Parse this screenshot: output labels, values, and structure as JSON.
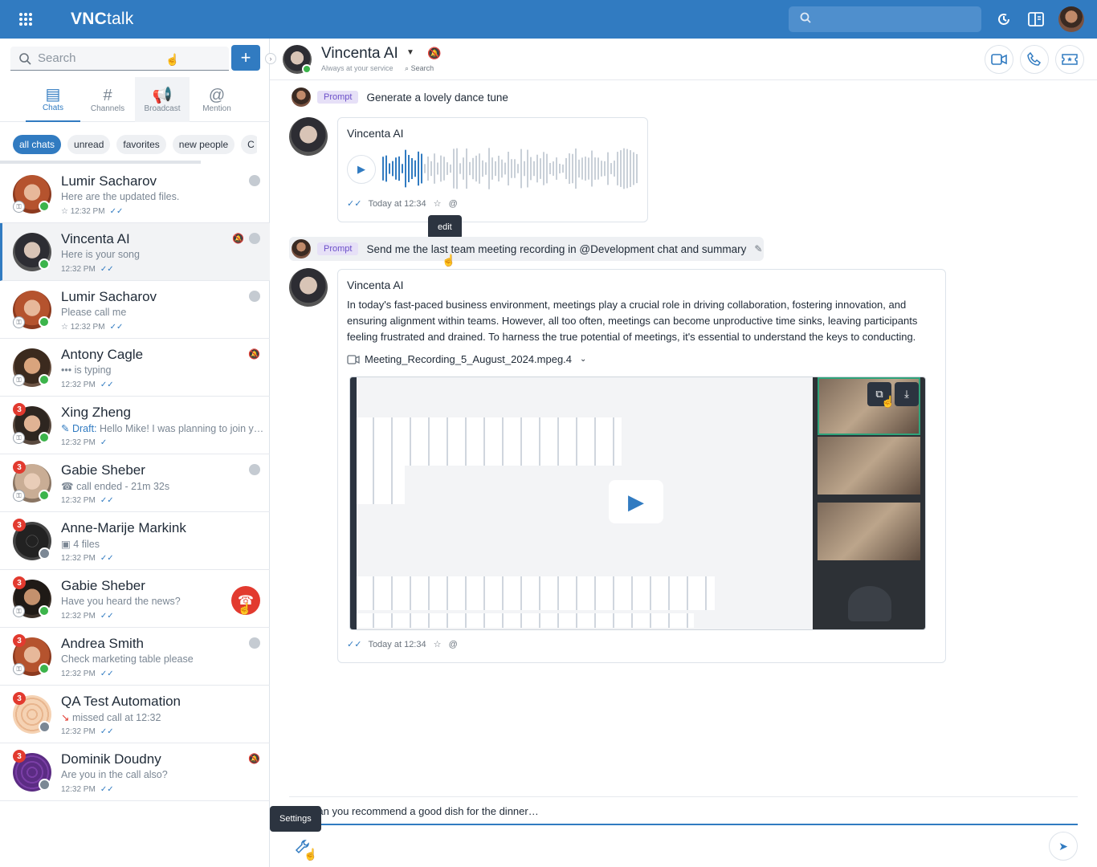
{
  "app": {
    "logo_bold": "VNC",
    "logo_light": "talk"
  },
  "topbar": {
    "icons": [
      "apps-grid-icon",
      "search-icon",
      "history-icon",
      "panel-icon",
      "user-avatar"
    ]
  },
  "sidebar": {
    "search_placeholder": "Search",
    "tabs": [
      {
        "label": "Chats",
        "icon": "chat-icon"
      },
      {
        "label": "Channels",
        "icon": "hash-icon"
      },
      {
        "label": "Broadcast",
        "icon": "megaphone-icon"
      },
      {
        "label": "Mention",
        "icon": "at-icon"
      }
    ],
    "filters": [
      "all chats",
      "unread",
      "favorites",
      "new people",
      "C"
    ],
    "chats": [
      {
        "name": "Lumir Sacharov",
        "msg": "Here are the updated files.",
        "time": "12:32 PM",
        "badge": ""
      },
      {
        "name": "Vincenta AI",
        "msg": "Here is your song",
        "time": "12:32 PM",
        "badge": ""
      },
      {
        "name": "Lumir Sacharov",
        "msg": "Please call me",
        "time": "12:32 PM",
        "badge": ""
      },
      {
        "name": "Antony Cagle",
        "msg": "is typing",
        "time": "12:32 PM",
        "badge": ""
      },
      {
        "name": "Xing Zheng",
        "draft": "Draft:",
        "msg": "Hello Mike! I was planning to join yo…",
        "time": "12:32 PM",
        "badge": "3"
      },
      {
        "name": "Gabie Sheber",
        "msg": "call ended - 21m 32s",
        "time": "12:32 PM",
        "badge": "3"
      },
      {
        "name": "Anne-Marije Markink",
        "msg": "4 files",
        "time": "12:32 PM",
        "badge": "3"
      },
      {
        "name": "Gabie Sheber",
        "msg": "Have you heard the news?",
        "time": "12:32 PM",
        "badge": "3"
      },
      {
        "name": "Andrea Smith",
        "msg": "Check marketing table please",
        "time": "12:32 PM",
        "badge": "3"
      },
      {
        "name": "QA Test Automation",
        "msg": "missed call at 12:32",
        "time": "12:32 PM",
        "badge": "3"
      },
      {
        "name": "Dominik Doudny",
        "msg": "Are you in the call also?",
        "time": "12:32 PM",
        "badge": "3"
      }
    ]
  },
  "header": {
    "name": "Vincenta AI",
    "subtitle": "Always at your service",
    "search_label": "Search"
  },
  "messages": {
    "prompt_tag": "Prompt",
    "prompt1": "Generate a lovely dance tune",
    "prompt2": "Send me the last team meeting recording in @Development chat and summary",
    "bot_name": "Vincenta AI",
    "meta_time": "Today at 12:34",
    "ai_text": "In today's fast-paced business environment, meetings play a crucial role in driving collaboration, fostering innovation, and ensuring alignment within teams. However, all too often, meetings can become unproductive time sinks, leaving participants feeling frustrated and drained. To harness the true potential of meetings, it's essential to understand the keys to conducting.",
    "file_name": "Meeting_Recording_5_August_2024.mpeg.4"
  },
  "tooltips": {
    "edit": "edit",
    "settings": "Settings"
  },
  "composer": {
    "text": "Can you recommend a good dish for the dinner…"
  },
  "colors": {
    "brand": "#317bc1",
    "danger": "#e23a2f",
    "online": "#3cb44b",
    "prompt_tag": "#6b4fc8"
  }
}
